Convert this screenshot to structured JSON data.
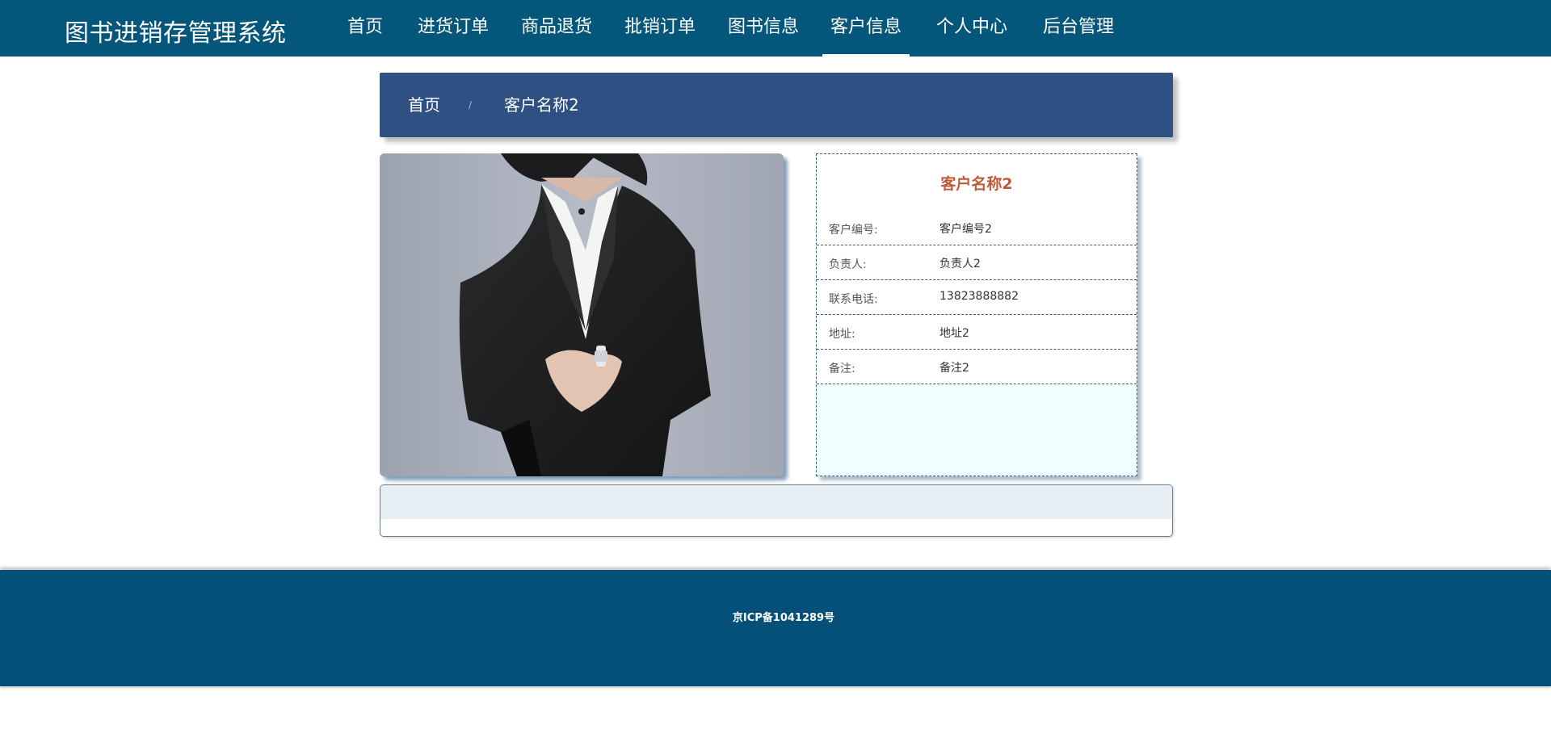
{
  "app": {
    "title": "图书进销存管理系统"
  },
  "nav": {
    "items": [
      {
        "label": "首页"
      },
      {
        "label": "进货订单"
      },
      {
        "label": "商品退货"
      },
      {
        "label": "批销订单"
      },
      {
        "label": "图书信息"
      },
      {
        "label": "客户信息",
        "active": true
      },
      {
        "label": "个人中心"
      },
      {
        "label": "后台管理"
      }
    ]
  },
  "breadcrumb": {
    "home": "首页",
    "separator": "/",
    "current": "客户名称2"
  },
  "customer": {
    "name": "客户名称2",
    "fields": [
      {
        "label": "客户编号:",
        "value": "客户编号2"
      },
      {
        "label": "负责人:",
        "value": "负责人2"
      },
      {
        "label": "联系电话:",
        "value": "13823888882"
      },
      {
        "label": "地址:",
        "value": "地址2"
      },
      {
        "label": "备注:",
        "value": "备注2"
      }
    ]
  },
  "footer": {
    "icp": "京ICP备1041289号"
  },
  "colors": {
    "header": "#04567a",
    "breadcrumb": "#2e5082",
    "title": "#bd5a3a",
    "footer": "#045078",
    "card_bg": "#f0ffff"
  }
}
